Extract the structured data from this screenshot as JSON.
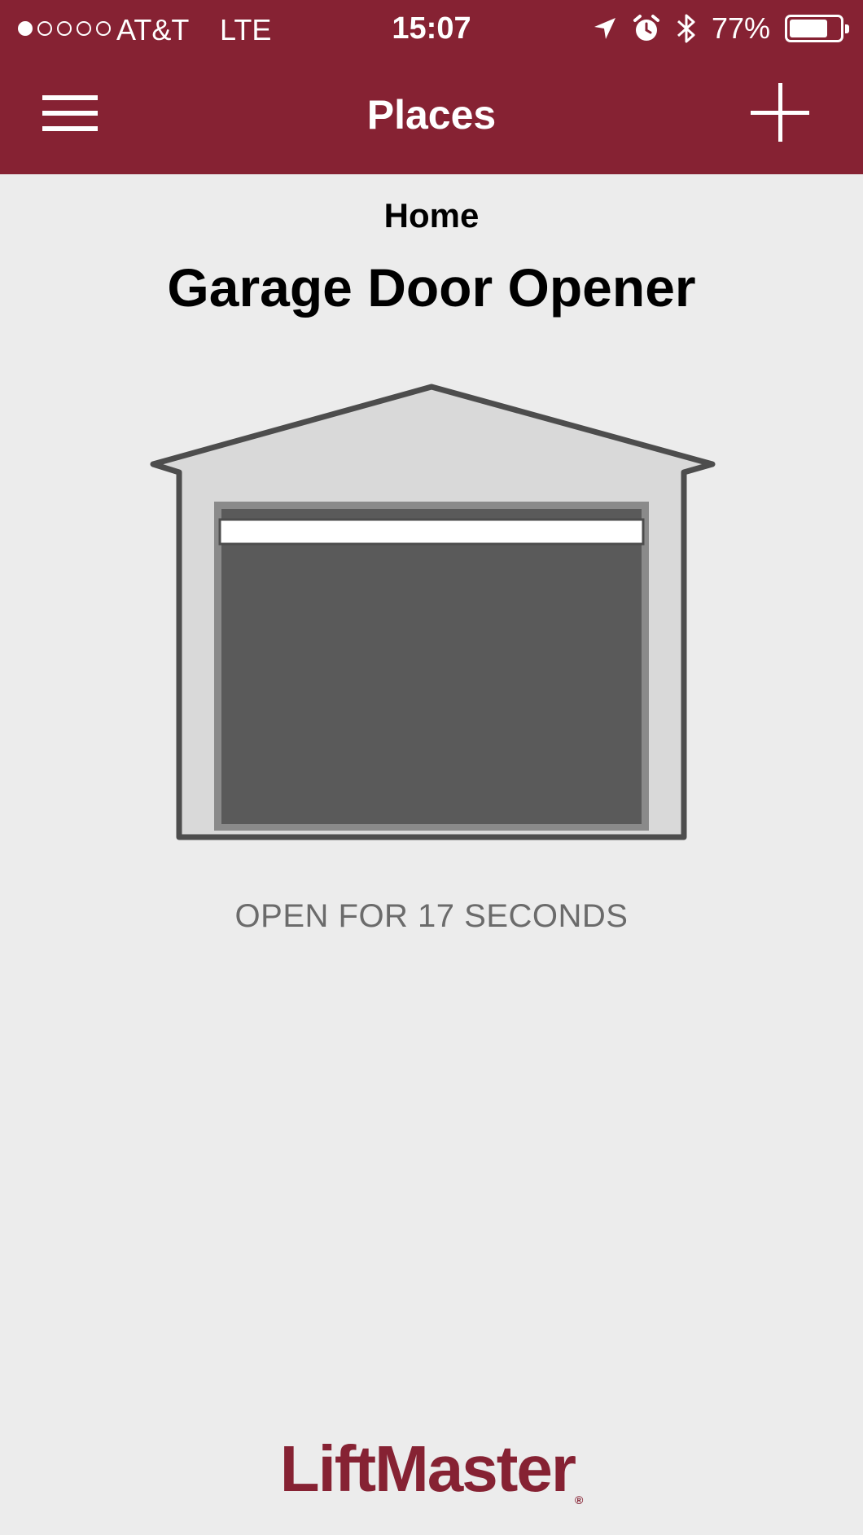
{
  "status_bar": {
    "carrier": "AT&T",
    "network": "LTE",
    "time": "15:07",
    "battery_percent_text": "77%",
    "battery_level": 0.77,
    "signal_bars_filled": 1,
    "signal_bars_total": 5,
    "icons": [
      "location-arrow-icon",
      "alarm-icon",
      "bluetooth-icon",
      "battery-icon"
    ]
  },
  "nav": {
    "title": "Places",
    "left_icon": "hamburger-menu-icon",
    "right_icon": "plus-icon"
  },
  "device": {
    "place": "Home",
    "name": "Garage Door Opener",
    "status": "OPEN FOR 17 SECONDS",
    "icon": "garage-door-open-icon"
  },
  "brand": {
    "logo_text": "LiftMaster",
    "registered_mark": "®"
  },
  "colors": {
    "header_bg": "#862233",
    "page_bg": "#ececec",
    "status_text": "#6b6b6b",
    "brand": "#862233",
    "garage_outline": "#4d4d4d",
    "garage_fill": "#d9d9d9",
    "door_opening": "#5a5a5a",
    "door_frame": "#8a8a8a"
  }
}
